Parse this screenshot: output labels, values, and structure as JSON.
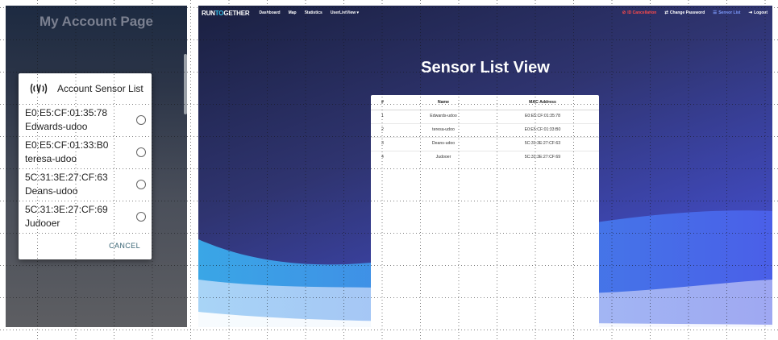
{
  "mobile": {
    "title": "My Account Page",
    "dialog": {
      "title": "Account Sensor List",
      "icon": "sensor-signal-icon",
      "items": [
        {
          "mac": "E0:E5:CF:01:35:78",
          "name": "Edwards-udoo"
        },
        {
          "mac": "E0:E5:CF:01:33:B0",
          "name": "teresa-udoo"
        },
        {
          "mac": "5C:31:3E:27:CF:63",
          "name": "Deans-udoo"
        },
        {
          "mac": "5C:31:3E:27:CF:69",
          "name": "Judooer"
        }
      ],
      "cancel_label": "CANCEL"
    }
  },
  "web": {
    "brand": {
      "part1": "RUN",
      "part2": "TO",
      "part3": "GETHER"
    },
    "nav": {
      "dashboard": "Dashboard",
      "map": "Map",
      "statistics": "Statistics",
      "userlistview": "UserListView ▾"
    },
    "nav_right": {
      "id_cancel": "ID Cancellation",
      "change_password": "Change Password",
      "sensor_list": "Sensor List",
      "logout": "Logout"
    },
    "page_title": "Sensor List View",
    "table": {
      "headers": {
        "idx": "#",
        "name": "Name",
        "mac": "MAC Address"
      },
      "rows": [
        {
          "idx": "1",
          "name": "Edwards-udoo",
          "mac": "E0:E5:CF:01:35:78"
        },
        {
          "idx": "2",
          "name": "teresa-udoo",
          "mac": "E0:E5:CF:01:33:B0"
        },
        {
          "idx": "3",
          "name": "Deans-udoo",
          "mac": "5C:31:3E:27:CF:63"
        },
        {
          "idx": "4",
          "name": "Judooer",
          "mac": "5C:31:3E:27:CF:69"
        }
      ]
    }
  },
  "colors": {
    "brand_accent": "#35c0e8",
    "danger": "#ff4a4a",
    "active_nav": "#7f9dff",
    "cancel_text": "#3a6575"
  }
}
